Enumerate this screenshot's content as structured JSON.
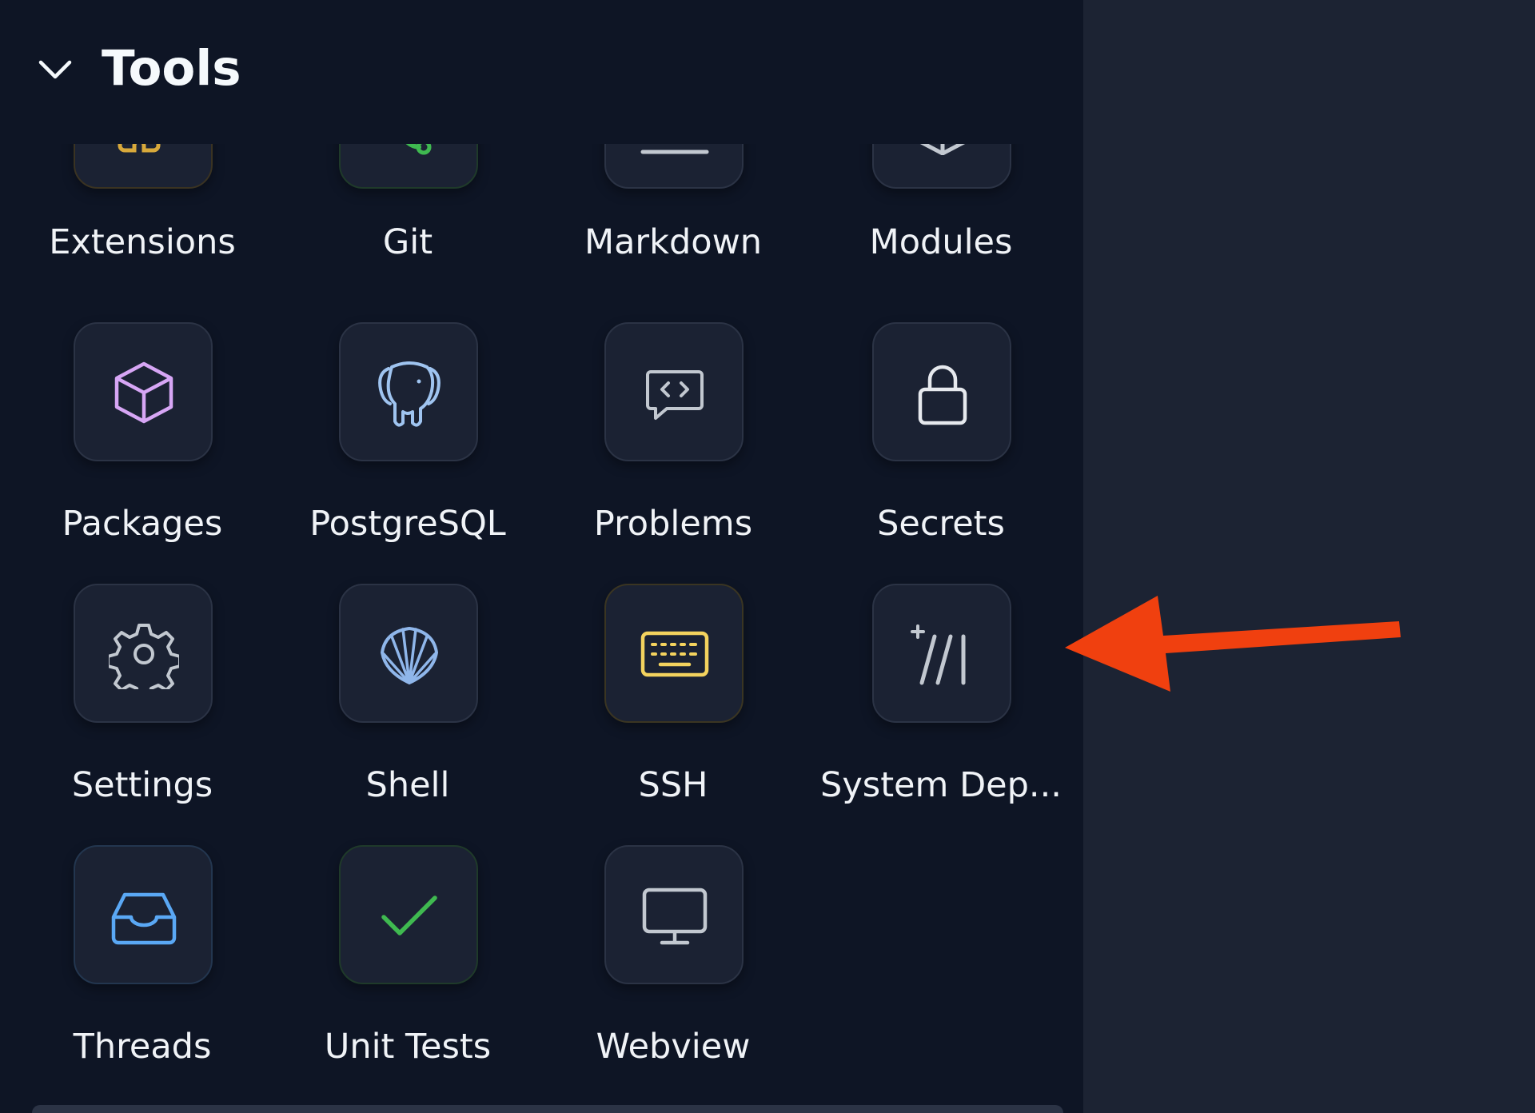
{
  "section": {
    "title": "Tools",
    "collapse_icon": "chevron-down-icon"
  },
  "tools": [
    {
      "label": "Extensions",
      "icon": "extensions-icon",
      "color": "#d8a93b"
    },
    {
      "label": "Git",
      "icon": "git-icon",
      "color": "#3fb950"
    },
    {
      "label": "Markdown",
      "icon": "markdown-icon",
      "color": "#c2c8d0"
    },
    {
      "label": "Modules",
      "icon": "modules-icon",
      "color": "#c2c8d0"
    },
    {
      "label": "Packages",
      "icon": "cube-icon",
      "color": "#d7a6f5"
    },
    {
      "label": "PostgreSQL",
      "icon": "postgresql-elephant-icon",
      "color": "#9fc4f0"
    },
    {
      "label": "Problems",
      "icon": "code-message-icon",
      "color": "#c2c8d0"
    },
    {
      "label": "Secrets",
      "icon": "lock-icon",
      "color": "#e6e9ee"
    },
    {
      "label": "Settings",
      "icon": "gear-icon",
      "color": "#c2c8d0"
    },
    {
      "label": "Shell",
      "icon": "shell-icon",
      "color": "#8fb6ea"
    },
    {
      "label": "SSH",
      "icon": "keyboard-icon",
      "color": "#f4d35e"
    },
    {
      "label": "System Dep...",
      "icon": "system-dependencies-icon",
      "color": "#c2c8d0"
    },
    {
      "label": "Threads",
      "icon": "inbox-icon",
      "color": "#5aa8f5"
    },
    {
      "label": "Unit Tests",
      "icon": "checkmark-icon",
      "color": "#3fb950"
    },
    {
      "label": "Webview",
      "icon": "monitor-icon",
      "color": "#c2c8d0"
    }
  ],
  "annotation": {
    "icon": "red-arrow-pointer-icon",
    "color": "#f0400f"
  }
}
